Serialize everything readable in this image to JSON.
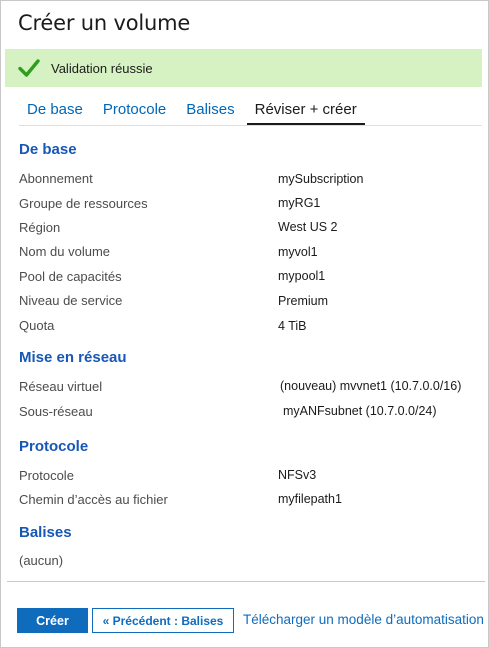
{
  "title": "Créer un volume",
  "banner": {
    "message": "Validation réussie",
    "color": "#d7f2c2",
    "icon": "check-icon"
  },
  "tabs": [
    {
      "label": "De base"
    },
    {
      "label": "Protocole"
    },
    {
      "label": "Balises"
    },
    {
      "label": "Réviser + créer",
      "active": true
    }
  ],
  "sections": {
    "basics": {
      "title": "De base",
      "rows": [
        {
          "label": "Abonnement",
          "value": "mySubscription"
        },
        {
          "label": "Groupe de ressources",
          "value": "myRG1"
        },
        {
          "label": "Région",
          "value": "West US 2"
        },
        {
          "label": "Nom du volume",
          "value": "myvol1"
        },
        {
          "label": "Pool de capacités",
          "value": "mypool1"
        },
        {
          "label": "Niveau de service",
          "value": "Premium"
        },
        {
          "label": "Quota",
          "value": "4 TiB"
        }
      ]
    },
    "networking": {
      "title": "Mise en réseau",
      "rows": [
        {
          "label": "Réseau virtuel",
          "value": "(nouveau) mvvnet1 (10.7.0.0/16)"
        },
        {
          "label": "Sous-réseau",
          "value": "myANFsubnet (10.7.0.0/24)"
        }
      ]
    },
    "protocol": {
      "title": "Protocole",
      "rows": [
        {
          "label": "Protocole",
          "value": "NFSv3"
        },
        {
          "label": "Chemin d’accès au fichier",
          "value": "myfilepath1"
        }
      ]
    },
    "tags": {
      "title": "Balises",
      "empty_text": "(aucun)"
    }
  },
  "footer": {
    "create_label": "Créer",
    "previous_label": "« Précédent : Balises",
    "download_label": "Télécharger un modèle d’automatisation"
  },
  "colors": {
    "accent": "#0f6cbd",
    "section_title": "#1857b6"
  }
}
